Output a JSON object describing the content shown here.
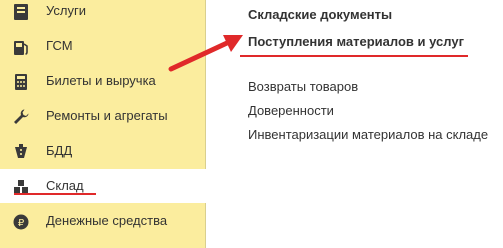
{
  "sidebar": {
    "items": [
      {
        "label": "Услуги",
        "icon": "services-icon"
      },
      {
        "label": "ГСМ",
        "icon": "fuel-icon"
      },
      {
        "label": "Билеты и выручка",
        "icon": "tickets-icon"
      },
      {
        "label": "Ремонты и агрегаты",
        "icon": "wrench-icon"
      },
      {
        "label": "БДД",
        "icon": "road-safety-icon"
      },
      {
        "label": "Склад",
        "icon": "warehouse-icon",
        "active": true
      },
      {
        "label": "Денежные средства",
        "icon": "money-icon"
      }
    ]
  },
  "main": {
    "title": "Складские документы",
    "links": [
      {
        "label": "Поступления материалов и услуг",
        "bold": true
      },
      {
        "label": "Возвраты товаров"
      },
      {
        "label": "Доверенности"
      },
      {
        "label": "Инвентаризации материалов на складе"
      }
    ]
  },
  "colors": {
    "sidebar_bg": "#fbed9e",
    "annotation_red": "#e0292a",
    "icon_dark": "#3a3a3a"
  }
}
